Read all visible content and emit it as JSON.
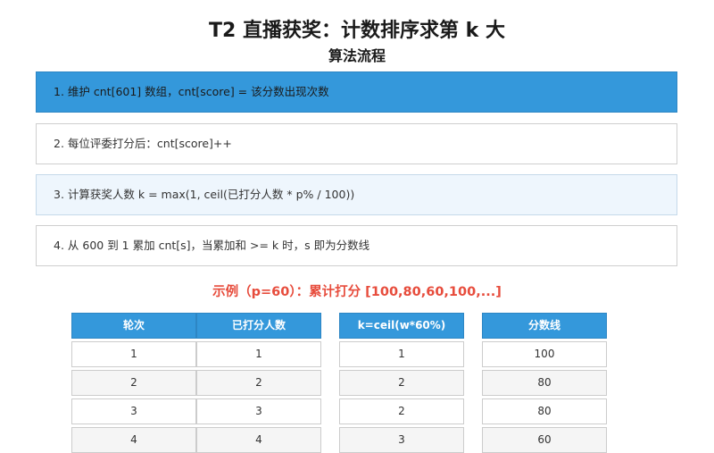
{
  "title": "T2 直播获奖：计数排序求第 k 大",
  "subtitle": "算法流程",
  "steps": [
    "1. 维护 cnt[601] 数组，cnt[score] = 该分数出现次数",
    "2. 每位评委打分后：cnt[score]++",
    "3. 计算获奖人数 k = max(1, ceil(已打分人数 * p% / 100))",
    "4. 从 600 到 1 累加 cnt[s]，当累加和 >= k 时，s 即为分数线"
  ],
  "example_title": "示例（p=60）：累计打分 [100,80,60,100,...]",
  "table1": {
    "headers": [
      "轮次",
      "已打分人数"
    ],
    "rows": [
      [
        "1",
        "1"
      ],
      [
        "2",
        "2"
      ],
      [
        "3",
        "3"
      ],
      [
        "4",
        "4"
      ]
    ]
  },
  "table2": {
    "headers": [
      "k=ceil(w*60%)"
    ],
    "rows": [
      [
        "1"
      ],
      [
        "2"
      ],
      [
        "2"
      ],
      [
        "3"
      ]
    ]
  },
  "table3": {
    "headers": [
      "分数线"
    ],
    "rows": [
      [
        "100"
      ],
      [
        "80"
      ],
      [
        "80"
      ],
      [
        "60"
      ]
    ]
  },
  "colors": {
    "accent_blue": "#3498db",
    "example_red": "#e74c3c",
    "light_step": "#eef6fd"
  }
}
